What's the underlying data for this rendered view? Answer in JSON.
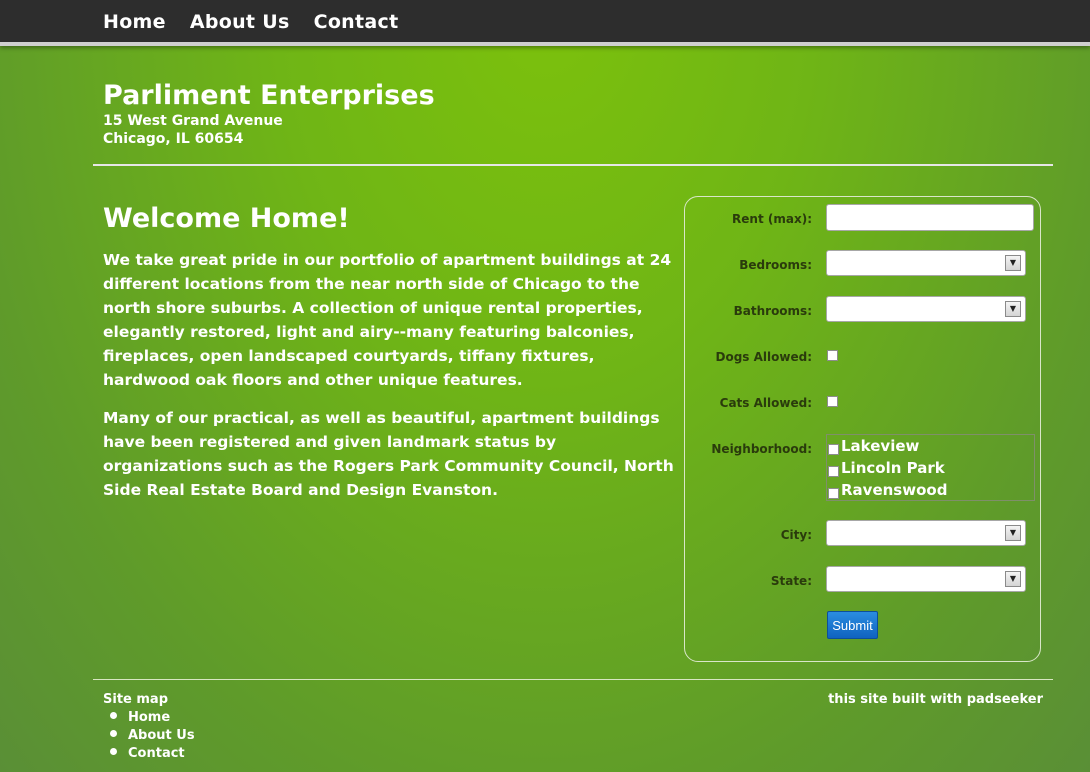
{
  "nav": {
    "items": [
      "Home",
      "About Us",
      "Contact"
    ]
  },
  "header": {
    "company": "Parliment Enterprises",
    "address_line1": "15 West Grand Avenue",
    "address_line2": "Chicago, IL 60654"
  },
  "main": {
    "heading": "Welcome Home!",
    "paragraphs": [
      "We take great pride in our portfolio of apartment buildings at 24 different locations from the near north side of Chicago to the north shore suburbs. A collection of unique rental properties, elegantly restored, light and airy--many featuring balconies, fireplaces, open landscaped courtyards, tiffany fixtures, hardwood oak floors and other unique features.",
      "Many of our practical, as well as beautiful, apartment buildings have been registered and given landmark status by organizations such as the Rogers Park Community Council, North Side Real Estate Board and Design Evanston."
    ]
  },
  "form": {
    "rent_label": "Rent (max):",
    "bedrooms_label": "Bedrooms:",
    "bathrooms_label": "Bathrooms:",
    "dogs_label": "Dogs Allowed:",
    "cats_label": "Cats Allowed:",
    "neighborhood_label": "Neighborhood:",
    "neighborhoods": [
      "Lakeview",
      "Lincoln Park",
      "Ravenswood"
    ],
    "city_label": "City:",
    "state_label": "State:",
    "submit_label": "Submit",
    "rent_value": "",
    "dogs_checked": false,
    "cats_checked": false
  },
  "footer": {
    "sitemap_label": "Site map",
    "links": [
      "Home",
      "About Us",
      "Contact"
    ],
    "credit": "this site built with padseeker"
  },
  "colors": {
    "topbar": "#2d2d2d",
    "background_green": "#6fb516",
    "submit_blue": "#1a73d0"
  }
}
